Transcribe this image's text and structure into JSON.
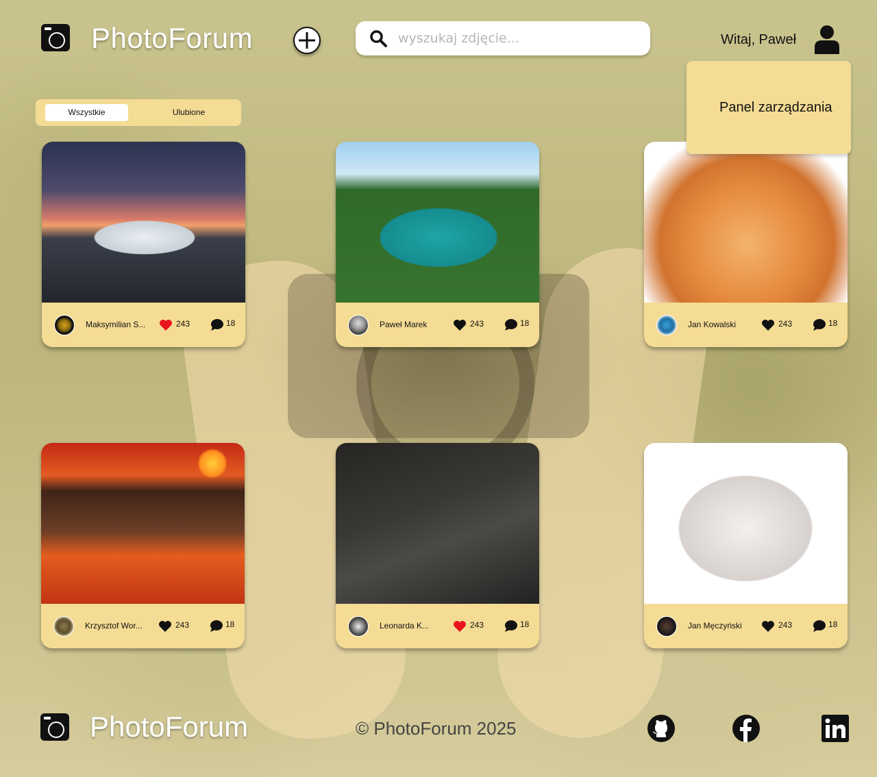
{
  "header": {
    "app_name": "PhotoForum",
    "search_placeholder": "wyszukaj zdjęcie...",
    "greeting": "Witaj, Paweł"
  },
  "dropdown": {
    "items": [
      {
        "label": "Panel zarządzania"
      }
    ]
  },
  "tabs": [
    {
      "label": "Wszystkie",
      "active": true
    },
    {
      "label": "Ulubione",
      "active": false
    }
  ],
  "posts": [
    {
      "author": "Maksymilian S...",
      "likes": "243",
      "comments": "18",
      "liked": true
    },
    {
      "author": "Paweł Marek",
      "likes": "243",
      "comments": "18",
      "liked": false
    },
    {
      "author": "Jan Kowalski",
      "likes": "243",
      "comments": "18",
      "liked": false
    },
    {
      "author": "Krzysztof Wor...",
      "likes": "243",
      "comments": "18",
      "liked": false
    },
    {
      "author": "Leonarda K...",
      "likes": "243",
      "comments": "18",
      "liked": true
    },
    {
      "author": "Jan Męczyński",
      "likes": "243",
      "comments": "18",
      "liked": false
    }
  ],
  "footer": {
    "app_name": "PhotoForum",
    "copyright": "© PhotoForum 2025",
    "social": [
      "github-icon",
      "facebook-icon",
      "linkedin-icon"
    ]
  },
  "colors": {
    "accent": "#f5dc94",
    "liked": "#e8141e",
    "text": "#111111"
  }
}
